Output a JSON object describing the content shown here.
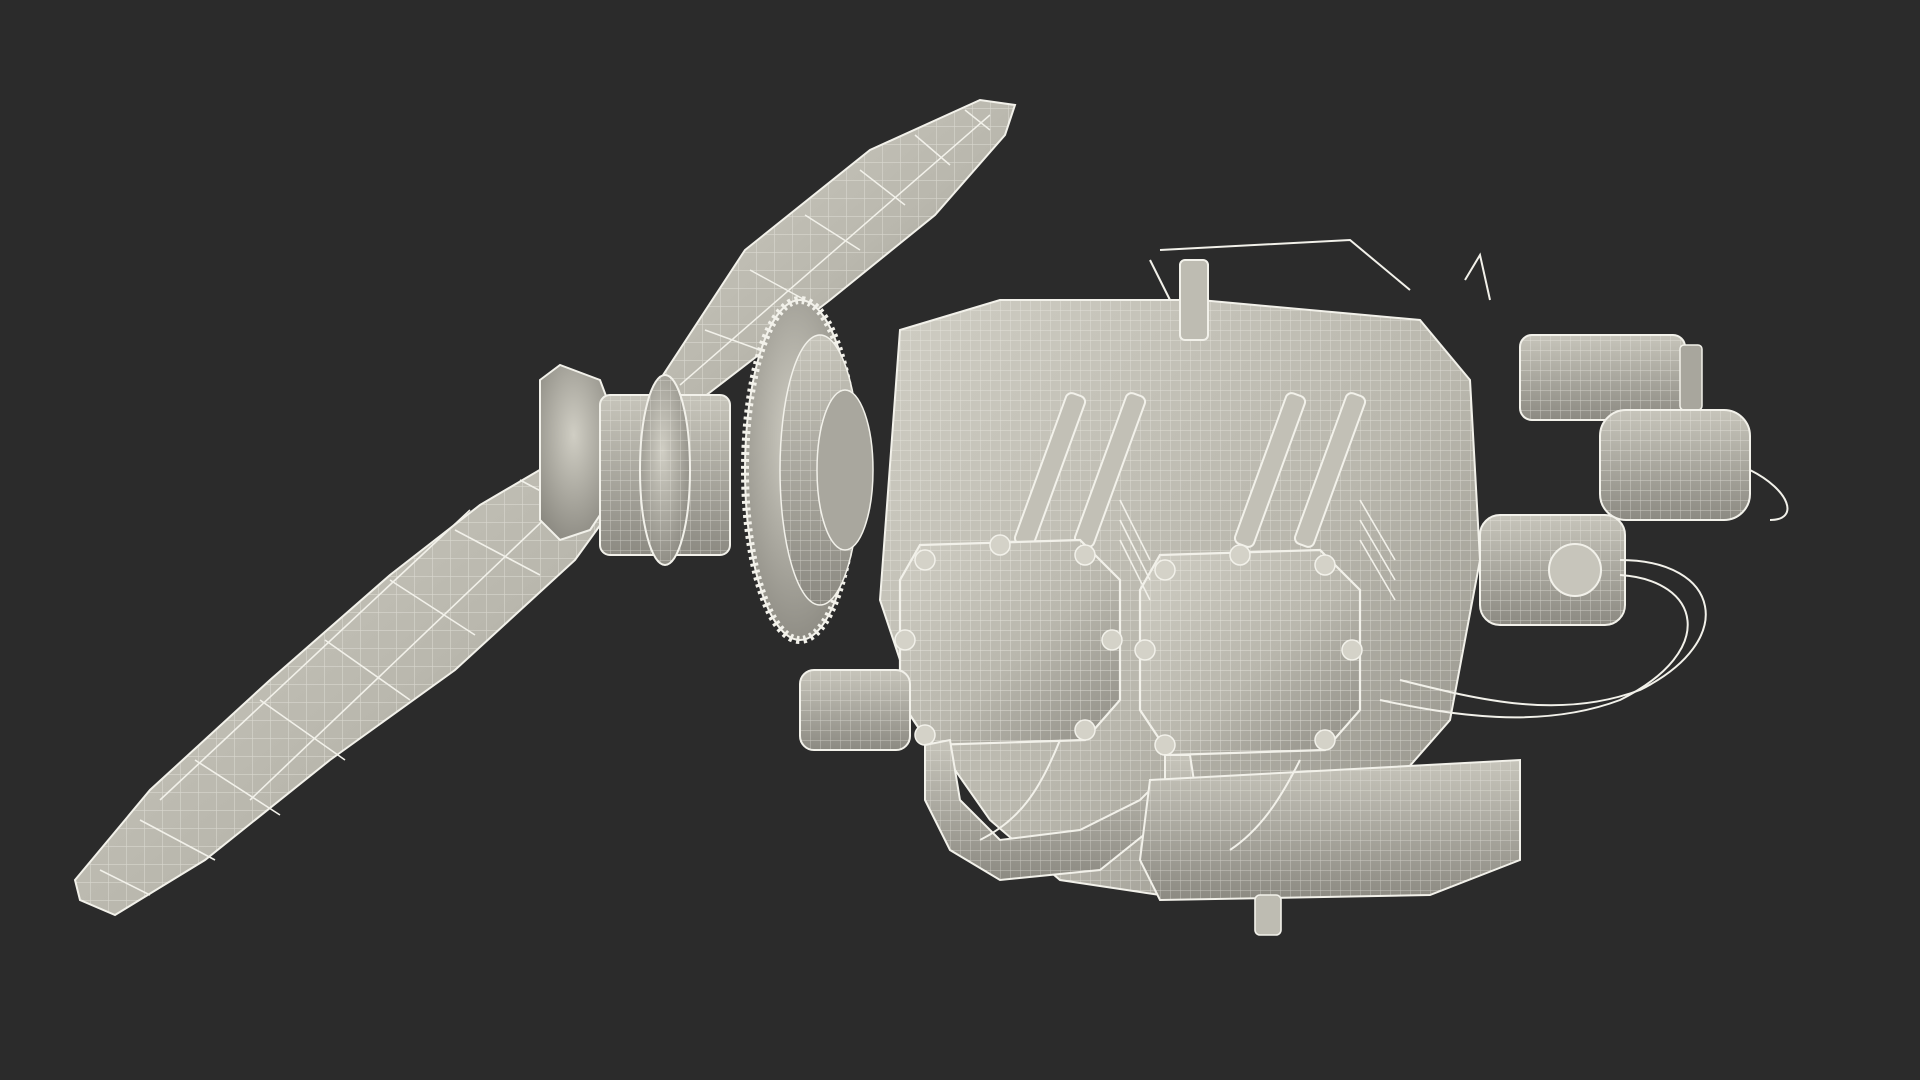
{
  "scene": {
    "subject": "wireframe-aircraft-engine-with-propeller",
    "colors": {
      "background": "#2b2b2b",
      "mesh_fill": "#b9b7ad",
      "mesh_fill_dark": "#9c9a91",
      "mesh_fill_light": "#cfcdc3",
      "wire": "#f2f1ea",
      "shadow": "#6d6b64"
    }
  }
}
